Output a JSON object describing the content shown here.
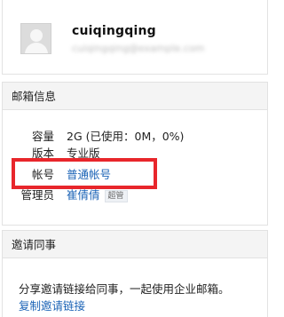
{
  "profile": {
    "username": "cuiqingqing",
    "email_masked": "cuiqingqing@example.com"
  },
  "mailbox_info": {
    "header": "邮箱信息",
    "rows": [
      {
        "label": "容量",
        "value": "2G (已使用：0M，0%)"
      },
      {
        "label": "版本",
        "value": "专业版"
      },
      {
        "label": "帐号",
        "value": "普通帐号"
      },
      {
        "label": "管理员",
        "value": "崔倩倩",
        "badge": "超管"
      }
    ]
  },
  "invite": {
    "header": "邀请同事",
    "description": "分享邀请链接给同事，一起使用企业邮箱。",
    "copy_link_label": "复制邀请链接"
  },
  "colors": {
    "link": "#1b63b6",
    "highlight": "#e8262b",
    "header_bg": "#f4f4f4"
  }
}
